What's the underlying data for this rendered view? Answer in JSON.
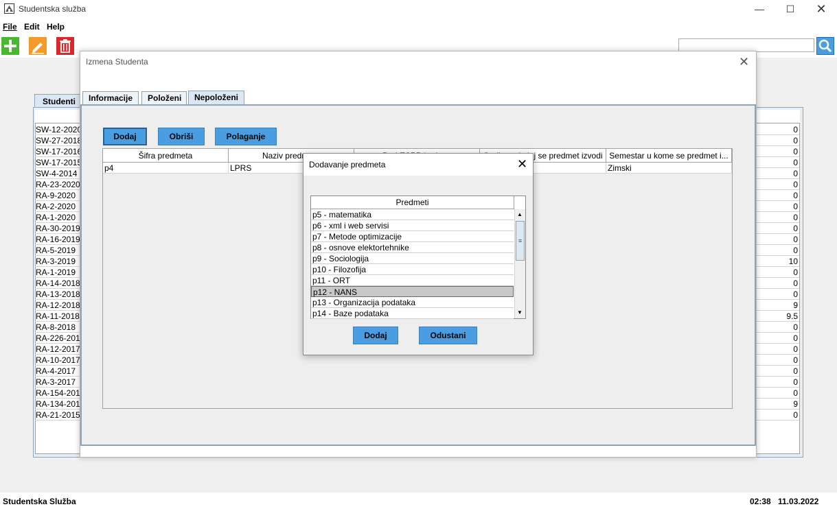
{
  "window": {
    "title": "Studentska služba"
  },
  "menu": {
    "file": "File",
    "edit": "Edit",
    "help": "Help"
  },
  "toolbar": {
    "add_icon": "plus-icon",
    "edit_icon": "pencil-icon",
    "delete_icon": "trash-icon",
    "search_value": ""
  },
  "main": {
    "tab": "Studenti",
    "rows": [
      {
        "index": "SW-12-2020",
        "value": "0"
      },
      {
        "index": "SW-27-2018",
        "value": "0"
      },
      {
        "index": "SW-17-2016",
        "value": "0"
      },
      {
        "index": "SW-17-2015",
        "value": "0"
      },
      {
        "index": "SW-4-2014",
        "value": "0"
      },
      {
        "index": "RA-23-2020",
        "value": "0"
      },
      {
        "index": "RA-9-2020",
        "value": "0"
      },
      {
        "index": "RA-2-2020",
        "value": "0"
      },
      {
        "index": "RA-1-2020",
        "value": "0"
      },
      {
        "index": "RA-30-2019",
        "value": "0"
      },
      {
        "index": "RA-16-2019",
        "value": "0"
      },
      {
        "index": "RA-5-2019",
        "value": "0"
      },
      {
        "index": "RA-3-2019",
        "value": "10"
      },
      {
        "index": "RA-1-2019",
        "value": "0"
      },
      {
        "index": "RA-14-2018",
        "value": "0"
      },
      {
        "index": "RA-13-2018",
        "value": "0"
      },
      {
        "index": "RA-12-2018",
        "value": "9"
      },
      {
        "index": "RA-11-2018",
        "value": "9.5"
      },
      {
        "index": "RA-8-2018",
        "value": "0"
      },
      {
        "index": "RA-226-201",
        "value": "0"
      },
      {
        "index": "RA-12-2017",
        "value": "0"
      },
      {
        "index": "RA-10-2017",
        "value": "0"
      },
      {
        "index": "RA-4-2017",
        "value": "0"
      },
      {
        "index": "RA-3-2017",
        "value": "0"
      },
      {
        "index": "RA-154-201",
        "value": "0"
      },
      {
        "index": "RA-134-201",
        "value": "9"
      },
      {
        "index": "RA-21-2015",
        "value": "0"
      }
    ]
  },
  "izmena": {
    "title": "Izmena Studenta",
    "tabs": [
      "Informacije",
      "Položeni",
      "Nepoloženi"
    ],
    "buttons": {
      "dodaj": "Dodaj",
      "obrisi": "Obriši",
      "polaganje": "Polaganje"
    },
    "columns": [
      "Šifra predmeta",
      "Naziv predmeta",
      "Broj ESPB bodova",
      "Godina u kojoj se predmet izvodi",
      "Semestar u kome se predmet i..."
    ],
    "rows": [
      {
        "sifra": "p4",
        "naziv": "LPRS",
        "espb": "",
        "godina": "",
        "semestar": "Zimski"
      }
    ]
  },
  "dodavanje": {
    "title": "Dodavanje predmeta",
    "header": "Predmeti",
    "items": [
      "p5 - matematika",
      "p6 - xml i web servisi",
      "p7 - Metode optimizacije",
      "p8 - osnove elektortehnike",
      "p9 - Sociologija",
      "p10 - Filozofija",
      "p11 - ORT",
      "p12 - NANS",
      "p13 - Organizacija podataka",
      "p14 - Baze podataka"
    ],
    "selected_index": 7,
    "dodaj": "Dodaj",
    "odustani": "Odustani"
  },
  "status": {
    "left": "Studentska Služba",
    "time": "02:38",
    "date": "11.03.2022"
  },
  "colors": {
    "accent": "#4a9de0",
    "tab_border": "#8ca3b8"
  }
}
